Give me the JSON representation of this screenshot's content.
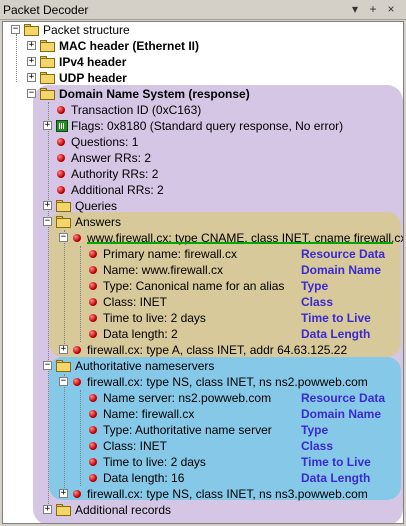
{
  "window": {
    "title": "Packet Decoder",
    "controls": [
      "▾",
      "+",
      "×"
    ]
  },
  "tree": {
    "root": "Packet structure",
    "mac": "MAC header (Ethernet II)",
    "ipv4": "IPv4 header",
    "udp": "UDP header",
    "dns": "Domain Name System (response)",
    "dns_fields": {
      "transaction_id": "Transaction ID (0xC163)",
      "flags": "Flags: 0x8180 (Standard query response, No error)",
      "questions": "Questions: 1",
      "answer_rrs": "Answer RRs: 2",
      "authority_rrs": "Authority RRs: 2",
      "additional_rrs": "Additional RRs: 2"
    },
    "queries": "Queries",
    "answers": "Answers",
    "answer1": {
      "label": "www.firewall.cx: type CNAME, class INET, cname firewall.cx",
      "fields": [
        {
          "text": "Primary name: firewall.cx",
          "note": "Resource Data"
        },
        {
          "text": "Name: www.firewall.cx",
          "note": "Domain Name"
        },
        {
          "text": "Type: Canonical name for an alias",
          "note": "Type"
        },
        {
          "text": "Class: INET",
          "note": "Class"
        },
        {
          "text": "Time to live: 2 days",
          "note": "Time to Live"
        },
        {
          "text": "Data length: 2",
          "note": "Data Length"
        }
      ]
    },
    "answer2": "firewall.cx: type A, class INET, addr 64.63.125.22",
    "authoritative": "Authoritative nameservers",
    "auth1": {
      "label": "firewall.cx: type NS, class INET, ns ns2.powweb.com",
      "fields": [
        {
          "text": "Name server: ns2.powweb.com",
          "note": "Resource Data"
        },
        {
          "text": "Name: firewall.cx",
          "note": "Domain Name"
        },
        {
          "text": "Type: Authoritative name server",
          "note": "Type"
        },
        {
          "text": "Class: INET",
          "note": "Class"
        },
        {
          "text": "Time to live: 2 days",
          "note": "Time to Live"
        },
        {
          "text": "Data length: 16",
          "note": "Data Length"
        }
      ]
    },
    "auth2": "firewall.cx: type NS, class INET, ns ns3.powweb.com",
    "additional": "Additional records"
  },
  "colors": {
    "dns_highlight": "#d6c6e6",
    "answers_highlight": "#d7c99a",
    "authority_highlight": "#86c8e8",
    "note_color": "#3a2ad0"
  }
}
